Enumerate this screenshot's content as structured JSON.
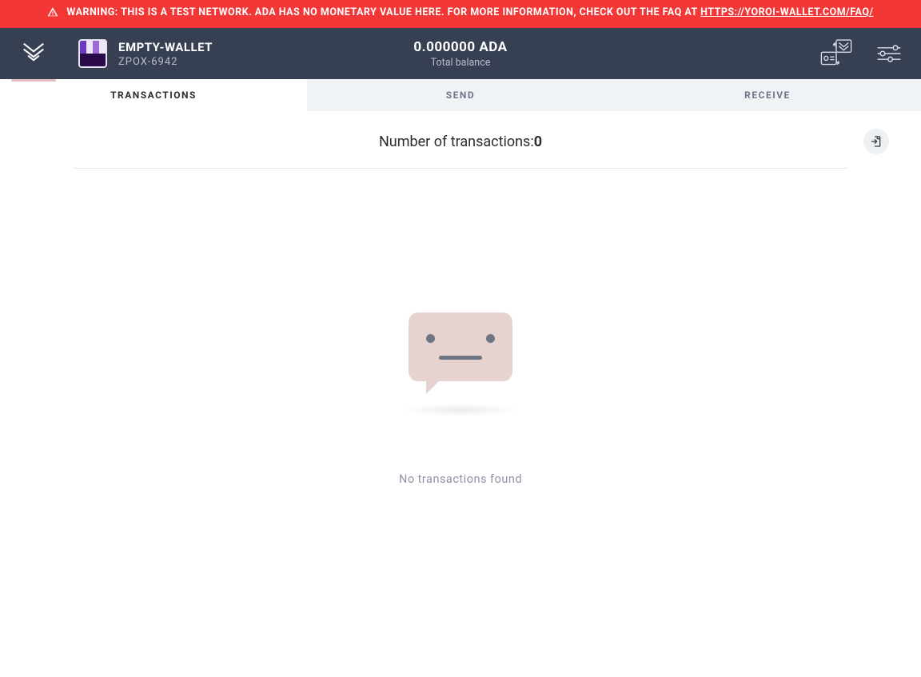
{
  "warning": {
    "prefix": "WARNING: THIS IS A TEST NETWORK. ADA HAS NO MONETARY VALUE HERE. FOR MORE INFORMATION, CHECK OUT THE FAQ AT ",
    "link_text": "HTTPS://YOROI-WALLET.COM/FAQ/"
  },
  "wallet": {
    "name": "EMPTY-WALLET",
    "hash": "ZPOX-6942"
  },
  "balance": {
    "amount": "0.000000 ADA",
    "label": "Total balance"
  },
  "tabs": {
    "transactions": "TRANSACTIONS",
    "send": "SEND",
    "receive": "RECEIVE"
  },
  "transactions": {
    "count_label": "Number of transactions: ",
    "count_value": "0",
    "empty_message": "No transactions found"
  }
}
